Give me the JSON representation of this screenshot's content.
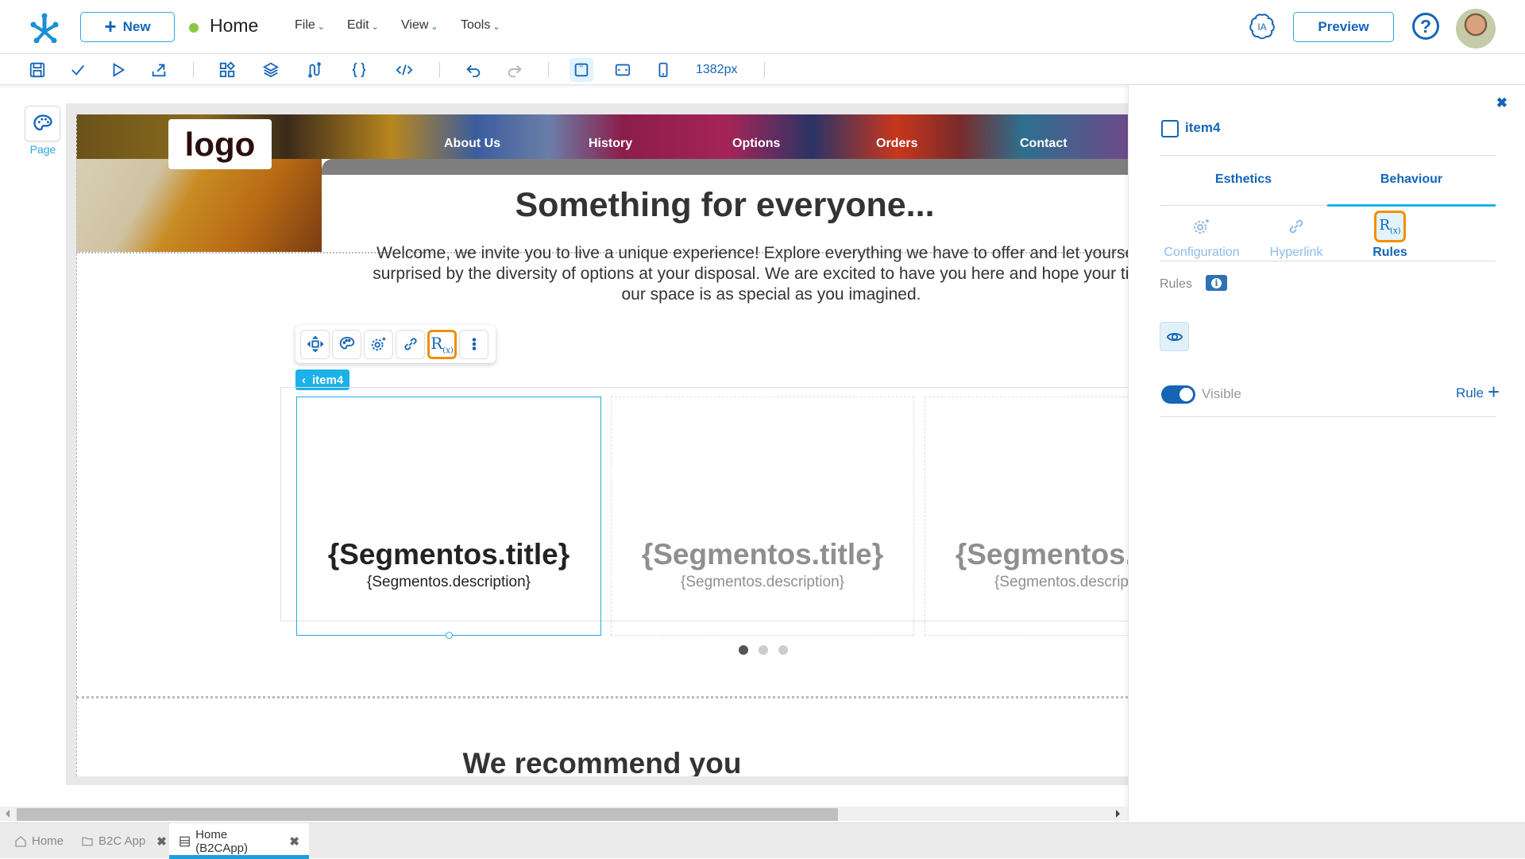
{
  "header": {
    "new_label": "New",
    "page_title": "Home",
    "status_color": "#8cc63f",
    "menus": [
      "File",
      "Edit",
      "View",
      "Tools"
    ],
    "ia_label": "IA",
    "preview_label": "Preview",
    "help_label": "?"
  },
  "toolbar": {
    "icons": [
      "save-icon",
      "check-icon",
      "play-icon",
      "export-icon",
      "components-icon",
      "layers-icon",
      "connectors-icon",
      "braces-icon",
      "code-icon",
      "undo-icon",
      "redo-icon",
      "desktop-view-icon",
      "tablet-view-icon",
      "mobile-view-icon"
    ],
    "width_label": "1382px"
  },
  "left_panel": {
    "page_label": "Page"
  },
  "canvas": {
    "logo_text": "logo",
    "nav_links": [
      "About Us",
      "History",
      "Options",
      "Orders",
      "Contact"
    ],
    "hero_title": "Something for everyone...",
    "hero_text": "Welcome, we invite you to live a unique experience! Explore everything we have to offer and let yourself be surprised by the diversity of options at your disposal. We are excited to have you here and hope your time in our space is as special as you imagined.",
    "selected_item_tag": "item4",
    "floating_toolbar": [
      "move-icon",
      "palette-icon",
      "settings-icon",
      "link-icon",
      "rules-icon",
      "more-icon"
    ],
    "rules_text": "R",
    "rules_sub": "(x)",
    "cards": [
      {
        "title": "{Segmentos.title}",
        "description": "{Segmentos.description}"
      },
      {
        "title": "{Segmentos.title}",
        "description": "{Segmentos.description}"
      },
      {
        "title": "{Segmentos.title}",
        "description": "{Segmentos.description}"
      }
    ],
    "carousel_pages": 3,
    "carousel_active_page": 1,
    "section_title": "We recommend you"
  },
  "panel": {
    "item_name": "item4",
    "tabs": [
      "Esthetics",
      "Behaviour"
    ],
    "active_tab": "Behaviour",
    "subtabs": [
      "Configuration",
      "Hyperlink",
      "Rules"
    ],
    "active_subtab": "Rules",
    "rules_label": "Rules",
    "visible_label": "Visible",
    "visible_on": true,
    "rule_add_label": "Rule",
    "accent_color": "#1565b7",
    "highlight_color": "#f18f01"
  },
  "bottom_tabs": [
    {
      "label": "Home",
      "icon": "home-icon",
      "closable": false
    },
    {
      "label": "B2C App",
      "icon": "folder-icon",
      "closable": true
    },
    {
      "label": "Home (B2CApp)",
      "icon": "page-icon",
      "closable": true,
      "active": true
    }
  ]
}
